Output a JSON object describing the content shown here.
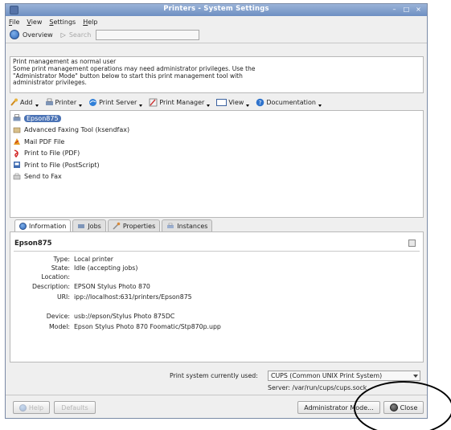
{
  "window": {
    "title": "Printers - System Settings"
  },
  "menu": [
    {
      "label": "File",
      "mn": "F",
      "rest": "ile"
    },
    {
      "label": "View",
      "mn": "V",
      "rest": "iew"
    },
    {
      "label": "Settings",
      "mn": "S",
      "rest": "ettings"
    },
    {
      "label": "Help",
      "mn": "H",
      "rest": "elp"
    }
  ],
  "nav": {
    "overview": "Overview",
    "search": "Search"
  },
  "notice": [
    "Print management as normal user",
    "Some print management operations may need administrator privileges. Use the",
    "\"Administrator Mode\" button below to start this print management tool with",
    "administrator privileges."
  ],
  "toolbar": [
    {
      "label": "Add",
      "icon": "add-icon"
    },
    {
      "label": "Printer",
      "icon": "printer-icon"
    },
    {
      "label": "Print Server",
      "icon": "print-server-icon"
    },
    {
      "label": "Print Manager",
      "icon": "print-manager-icon"
    },
    {
      "label": "View",
      "icon": "view-icon"
    },
    {
      "label": "Documentation",
      "icon": "help-icon"
    }
  ],
  "printers": [
    {
      "label": "Epson875",
      "selected": true
    },
    {
      "label": "Advanced Faxing Tool (ksendfax)"
    },
    {
      "label": "Mail PDF File"
    },
    {
      "label": "Print to File (PDF)"
    },
    {
      "label": "Print to File (PostScript)"
    },
    {
      "label": "Send to Fax"
    }
  ],
  "tabs": [
    "Information",
    "Jobs",
    "Properties",
    "Instances"
  ],
  "details": {
    "name": "Epson875",
    "rows": [
      {
        "key": "Type:",
        "value": "Local printer"
      },
      {
        "key": "State:",
        "value": "Idle (accepting jobs)"
      },
      {
        "key": "Location:",
        "value": ""
      },
      {
        "key": "Description:",
        "value": "EPSON Stylus Photo 870"
      },
      {
        "key": "URI:",
        "value": "ipp://localhost:631/printers/Epson875"
      },
      {
        "key": "Device:",
        "value": "usb://epson/Stylus Photo 875DC"
      },
      {
        "key": "Model:",
        "value": "Epson Stylus Photo 870 Foomatic/Stp870p.upp"
      }
    ]
  },
  "status": {
    "label": "Print system currently used:",
    "system": "CUPS (Common UNIX Print System)",
    "server": "Server: /var/run/cups/cups.sock"
  },
  "buttons": {
    "help": "Help",
    "defaults": "Defaults",
    "admin": "Administrator Mode...",
    "close": "Close"
  },
  "colors": {
    "selection": "#4b73b5",
    "titlebar": "#7b9bcc"
  }
}
